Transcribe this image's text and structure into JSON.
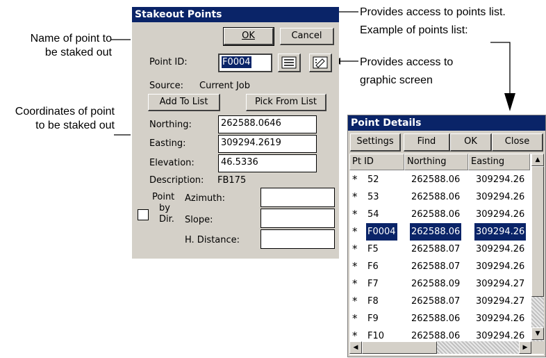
{
  "callouts": {
    "point_name": [
      "Name of point to",
      "be staked out"
    ],
    "coords": [
      "Coordinates of point",
      "to be staked out"
    ],
    "points_list": [
      "Provides access to points list.",
      "Example of points list:"
    ],
    "graphic": [
      "Provides access to",
      "graphic screen"
    ]
  },
  "stakeout": {
    "title": "Stakeout Points",
    "ok": "OK",
    "cancel": "Cancel",
    "point_id_label": "Point ID:",
    "point_id_value": "F0004",
    "source_label": "Source:",
    "source_value": "Current Job",
    "add_to_list": "Add To List",
    "pick_from_list": "Pick From List",
    "northing_label": "Northing:",
    "northing_value": "262588.0646",
    "easting_label": "Easting:",
    "easting_value": "309294.2619",
    "elevation_label": "Elevation:",
    "elevation_value": "46.5336",
    "description_label": "Description:",
    "description_value": "FB175",
    "point_by_dir": [
      "Point",
      "by",
      "Dir."
    ],
    "azimuth_label": "Azimuth:",
    "slope_label": "Slope:",
    "hdist_label": "H. Distance:"
  },
  "details": {
    "title": "Point Details",
    "settings": "Settings",
    "find": "Find",
    "ok": "OK",
    "close": "Close",
    "columns": [
      "Pt ID",
      "Northing",
      "Easting"
    ],
    "rows": [
      [
        "52",
        "262588.06",
        "309294.26"
      ],
      [
        "53",
        "262588.06",
        "309294.26"
      ],
      [
        "54",
        "262588.06",
        "309294.26"
      ],
      [
        "F0004",
        "262588.06",
        "309294.26"
      ],
      [
        "F5",
        "262588.07",
        "309294.26"
      ],
      [
        "F6",
        "262588.07",
        "309294.26"
      ],
      [
        "F7",
        "262588.09",
        "309294.27"
      ],
      [
        "F8",
        "262588.07",
        "309294.27"
      ],
      [
        "F9",
        "262588.06",
        "309294.26"
      ],
      [
        "F10",
        "262588.06",
        "309294.26"
      ]
    ],
    "selected_index": 3,
    "row_icon": "*"
  }
}
